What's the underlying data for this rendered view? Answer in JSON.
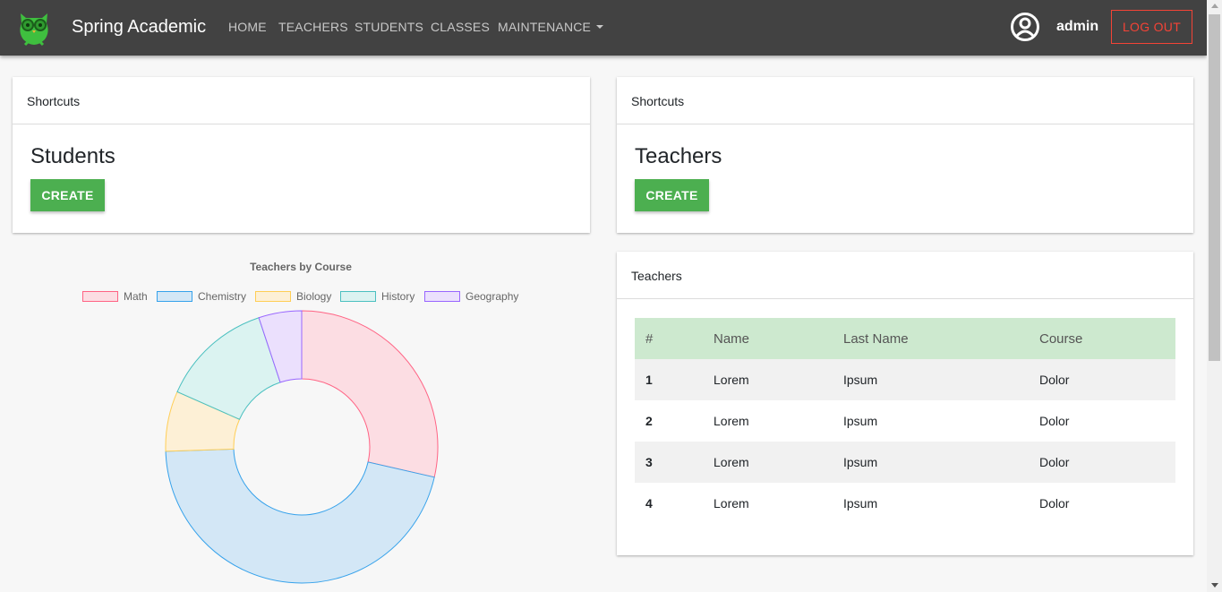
{
  "navbar": {
    "brand": "Spring Academic",
    "links": [
      "HOME",
      "TEACHERS",
      "STUDENTS",
      "CLASSES",
      "MAINTENANCE"
    ],
    "username": "admin",
    "logout": "LOG OUT"
  },
  "cards": {
    "students_shortcut": {
      "header": "Shortcuts",
      "title": "Students",
      "button": "CREATE"
    },
    "teachers_shortcut": {
      "header": "Shortcuts",
      "title": "Teachers",
      "button": "CREATE"
    },
    "teachers_table": {
      "header": "Teachers",
      "columns": [
        "#",
        "Name",
        "Last Name",
        "Course"
      ],
      "rows": [
        [
          "1",
          "Lorem",
          "Ipsum",
          "Dolor"
        ],
        [
          "2",
          "Lorem",
          "Ipsum",
          "Dolor"
        ],
        [
          "3",
          "Lorem",
          "Ipsum",
          "Dolor"
        ],
        [
          "4",
          "Lorem",
          "Ipsum",
          "Dolor"
        ]
      ]
    }
  },
  "chart_data": {
    "type": "pie",
    "title": "Teachers by Course",
    "legend_position": "top",
    "categories": [
      "Math",
      "Chemistry",
      "Biology",
      "History",
      "Geography"
    ],
    "values": [
      28,
      45,
      7,
      13,
      5
    ],
    "fill_colors": [
      "#fcdde3",
      "#d3e7f6",
      "#fdf0d6",
      "#dbf3f1",
      "#ebe0fd"
    ],
    "border_colors": [
      "#ff6384",
      "#36a2eb",
      "#ffce56",
      "#4bc0c0",
      "#9966ff"
    ]
  }
}
